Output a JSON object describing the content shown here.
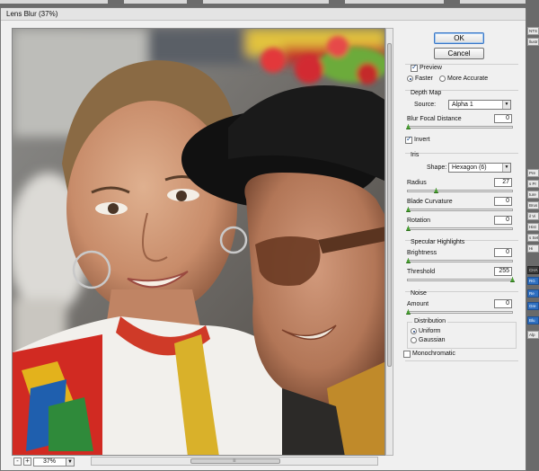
{
  "dialog": {
    "title": "Lens Blur (37%)",
    "ok_label": "OK",
    "cancel_label": "Cancel"
  },
  "preview_options": {
    "preview_label": "Preview",
    "preview_checked": true,
    "faster_label": "Faster",
    "more_accurate_label": "More Accurate",
    "selected_quality": "Faster"
  },
  "depth_map": {
    "group_label": "Depth Map",
    "source_label": "Source:",
    "source_value": "Alpha 1",
    "blur_focal_label": "Blur Focal Distance",
    "blur_focal_value": "0",
    "invert_label": "Invert",
    "invert_checked": true
  },
  "iris": {
    "group_label": "Iris",
    "shape_label": "Shape:",
    "shape_value": "Hexagon (6)",
    "radius_label": "Radius",
    "radius_value": "27",
    "blade_curvature_label": "Blade Curvature",
    "blade_curvature_value": "0",
    "rotation_label": "Rotation",
    "rotation_value": "0"
  },
  "specular": {
    "group_label": "Specular Highlights",
    "brightness_label": "Brightness",
    "brightness_value": "0",
    "threshold_label": "Threshold",
    "threshold_value": "255"
  },
  "noise": {
    "group_label": "Noise",
    "amount_label": "Amount",
    "amount_value": "0",
    "distribution_label": "Distribution",
    "uniform_label": "Uniform",
    "gaussian_label": "Gaussian",
    "selected_distribution": "Uniform",
    "monochromatic_label": "Monochromatic",
    "monochromatic_checked": false
  },
  "zoom": {
    "value": "37%",
    "minus_label": "-",
    "plus_label": "+"
  },
  "background_panel": {
    "items": [
      "NTS",
      "llustr",
      "Pre",
      "s Pr",
      "ture",
      "Brus",
      "il Vi",
      "Hist",
      "s Set",
      "Hi",
      "CHA",
      "RG",
      "Re",
      "Gre",
      "Blu",
      "Alp"
    ]
  },
  "colors": {
    "ok_border": "#3b77c6",
    "slider_handle": "#48a030",
    "channel_blue": "#2f6fc0"
  }
}
